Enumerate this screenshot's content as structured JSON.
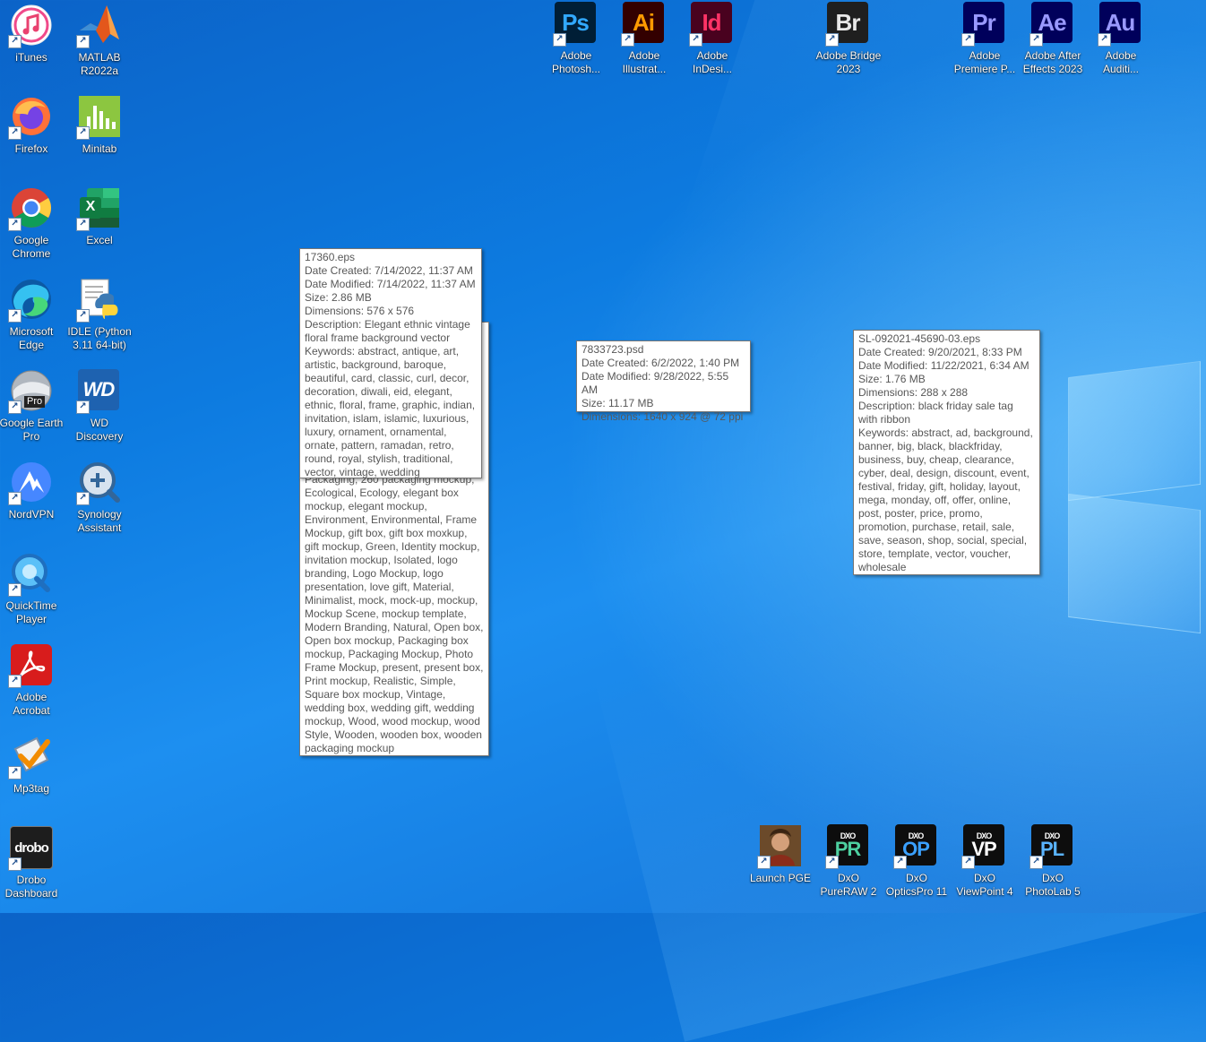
{
  "desktop": {
    "icons": [
      {
        "label": "iTunes"
      },
      {
        "label": "MATLAB\nR2022a"
      },
      {
        "label": "Firefox"
      },
      {
        "label": "Minitab"
      },
      {
        "label": "Google\nChrome"
      },
      {
        "label": "Excel"
      },
      {
        "label": "Microsoft\nEdge"
      },
      {
        "label": "IDLE (Python\n3.11 64-bit)"
      },
      {
        "label": "Google Earth\nPro"
      },
      {
        "label": "WD\nDiscovery"
      },
      {
        "label": "NordVPN"
      },
      {
        "label": "Synology\nAssistant"
      },
      {
        "label": "QuickTime\nPlayer"
      },
      {
        "label": "Adobe\nAcrobat"
      },
      {
        "label": "Mp3tag"
      },
      {
        "label": "Drobo\nDashboard"
      },
      {
        "label": "Adobe\nPhotosh...",
        "glyph": "Ps"
      },
      {
        "label": "Adobe\nIllustrat...",
        "glyph": "Ai"
      },
      {
        "label": "Adobe\nInDesi...",
        "glyph": "Id"
      },
      {
        "label": "Adobe Bridge\n2023",
        "glyph": "Br"
      },
      {
        "label": "Adobe\nPremiere P...",
        "glyph": "Pr"
      },
      {
        "label": "Adobe After\nEffects 2023",
        "glyph": "Ae"
      },
      {
        "label": "Adobe\nAuditi...",
        "glyph": "Au"
      },
      {
        "label": "Launch PGE"
      },
      {
        "label": "DxO\nPureRAW 2",
        "glyph": "PR"
      },
      {
        "label": "DxO\nOpticsPro 11",
        "glyph": "OP"
      },
      {
        "label": "DxO\nViewPoint 4",
        "glyph": "VP"
      },
      {
        "label": "DxO\nPhotoLab 5",
        "glyph": "PL"
      }
    ],
    "badges": {
      "google_earth": "Pro",
      "wd": "WD",
      "drobo": "drobo",
      "dxo": "DXO",
      "excel": "X"
    }
  },
  "tooltips": {
    "eps1": {
      "lines": [
        "17360.eps",
        "Date Created: 7/14/2022, 11:37 AM",
        "Date Modified: 7/14/2022, 11:37 AM",
        "Size: 2.86 MB",
        "Dimensions: 576 x 576",
        "Description: Elegant ethnic vintage floral frame background vector",
        "Keywords: abstract, antique, art, artistic, background, baroque, beautiful, card, classic, curl, decor, decoration, diwali, eid, elegant, ethnic, floral, frame, graphic, indian, invitation, islam, islamic, luxurious, luxury, ornament, ornamental, ornate, pattern, ramadan, retro, round, royal, stylish, traditional, vector, vintage, wedding"
      ]
    },
    "behind": {
      "lines": [
        "Packaging, 260 packaging mockup,",
        "Ecological, Ecology, elegant box mockup, elegant mockup, Environment, Environmental, Frame Mockup, gift box, gift box moxkup, gift mockup, Green, Identity mockup, invitation mockup, Isolated, logo branding, Logo Mockup, logo presentation, love gift, Material, Minimalist, mock, mock-up, mockup, Mockup Scene, mockup template, Modern Branding, Natural, Open box, Open box mockup, Packaging box mockup, Packaging Mockup, Photo Frame Mockup, present, present box, Print mockup, Realistic, Simple, Square box mockup, Vintage, wedding box, wedding gift, wedding mockup, Wood, wood mockup, wood Style, Wooden, wooden box, wooden packaging mockup"
      ]
    },
    "psd": {
      "lines": [
        "7833723.psd",
        "Date Created: 6/2/2022, 1:40 PM",
        "Date Modified: 9/28/2022, 5:55 AM",
        "Size: 11.17 MB",
        "Dimensions: 1640 x 924 @ 72 ppi"
      ]
    },
    "eps2": {
      "lines": [
        "SL-092021-45690-03.eps",
        "Date Created: 9/20/2021, 8:33 PM",
        "Date Modified: 11/22/2021, 6:34 AM",
        "Size: 1.76 MB",
        "Dimensions: 288 x 288",
        "Description: black friday sale tag with ribbon",
        "Keywords: abstract, ad, background, banner, big, black, blackfriday, business, buy, cheap, clearance, cyber, deal, design, discount, event, festival, friday, gift, holiday, layout, mega, monday, off, offer, online, post, poster, price, promo, promotion, purchase, retail, sale, save, season, shop, social, special, store, template, vector, voucher, wholesale"
      ]
    }
  }
}
